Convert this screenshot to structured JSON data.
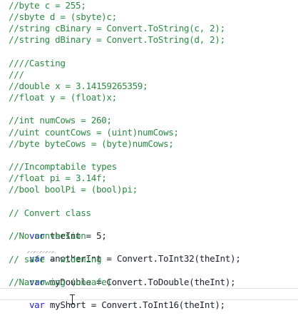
{
  "editor": {
    "lines": [
      {
        "kind": "comment",
        "text": "//byte c = 255;"
      },
      {
        "kind": "comment",
        "text": "//sbyte d = (sbyte)c;"
      },
      {
        "kind": "comment",
        "text": "//string cBinary = Convert.ToString(c, 2);"
      },
      {
        "kind": "comment",
        "text": "//string dBinary = Convert.ToString(d, 2);"
      },
      {
        "kind": "blank",
        "text": ""
      },
      {
        "kind": "comment",
        "text": "////Casting"
      },
      {
        "kind": "comment",
        "text": "///"
      },
      {
        "kind": "comment",
        "text": "//double x = 3.14159265359;"
      },
      {
        "kind": "comment",
        "text": "//float y = (float)x;"
      },
      {
        "kind": "blank",
        "text": ""
      },
      {
        "kind": "comment",
        "text": "//int numCows = 260;"
      },
      {
        "kind": "comment",
        "text": "//uint countCows = (uint)numCows;"
      },
      {
        "kind": "comment",
        "text": "//byte byteCows = (byte)numCows;"
      },
      {
        "kind": "blank",
        "text": ""
      },
      {
        "kind": "comment",
        "text": "///Incomptabile types"
      },
      {
        "kind": "comment",
        "text": "//float pi = 3.14f;"
      },
      {
        "kind": "comment",
        "text": "//bool boolPi = (bool)pi;"
      },
      {
        "kind": "blank",
        "text": ""
      },
      {
        "kind": "comment",
        "text": "// Convert class"
      },
      {
        "kind": "code",
        "keyword": "var",
        "name": "theInt",
        "rest": " = 5;"
      },
      {
        "kind": "comment",
        "text": "//No conversion"
      },
      {
        "kind": "code",
        "keyword": "var",
        "name": "anotherInt",
        "rest": " = Convert.ToInt32(theInt);"
      },
      {
        "kind": "comment",
        "text": "// safe - widening"
      },
      {
        "kind": "code",
        "keyword": "var",
        "name": "myDouble",
        "rest": " = Convert.ToDouble(theInt);"
      },
      {
        "kind": "comment",
        "text": "//Narrowing (unsafe)"
      },
      {
        "kind": "code",
        "keyword": "var",
        "name": "myShort",
        "rest": " = Convert.ToInt16(theInt);"
      }
    ]
  },
  "colors": {
    "comment": "#2a8b43",
    "keyword": "#1f1fd6",
    "text": "#1f1f2e",
    "background": "#ffffff"
  },
  "cursor": {
    "icon": "i-beam-cursor-icon"
  }
}
